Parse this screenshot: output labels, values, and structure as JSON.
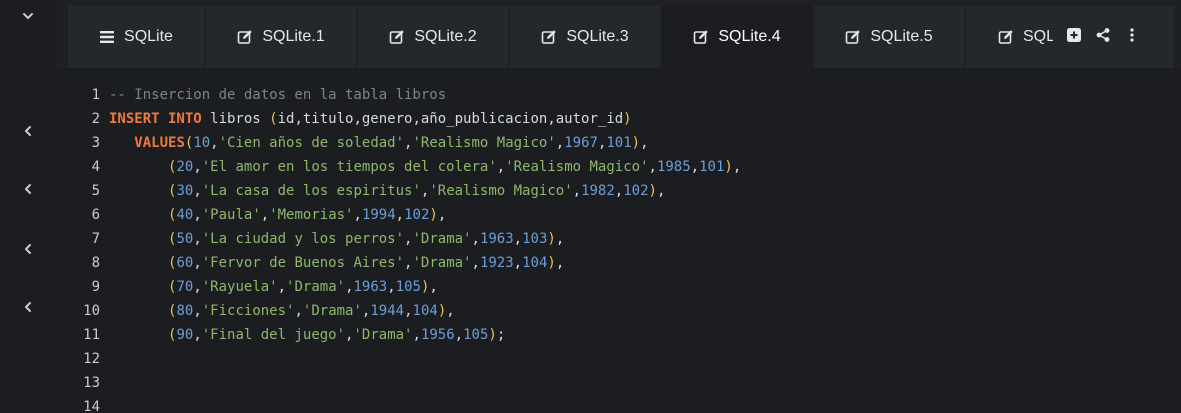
{
  "colors": {
    "background": "#1b1d20",
    "tab_bg": "#24272b",
    "keyword": "#ee7a3b",
    "number": "#6c9ed8",
    "string": "#8fb86a",
    "paren": "#e6c45a",
    "comment": "#7c848e"
  },
  "rail": {
    "items": [
      {
        "icon": "chevron-down-icon"
      },
      {
        "icon": "chevron-left-icon"
      },
      {
        "icon": "chevron-left-icon"
      },
      {
        "icon": "chevron-left-icon"
      },
      {
        "icon": "chevron-left-icon"
      }
    ]
  },
  "tabs": [
    {
      "label": "SQLite",
      "icon": "list-icon",
      "active": false
    },
    {
      "label": "SQLite.1",
      "icon": "edit-icon",
      "active": false
    },
    {
      "label": "SQLite.2",
      "icon": "edit-icon",
      "active": false
    },
    {
      "label": "SQLite.3",
      "icon": "edit-icon",
      "active": false
    },
    {
      "label": "SQLite.4",
      "icon": "edit-icon",
      "active": true
    },
    {
      "label": "SQLite.5",
      "icon": "edit-icon",
      "active": false
    },
    {
      "label": "SQL",
      "icon": "edit-icon",
      "active": false
    }
  ],
  "tab_actions": [
    {
      "icon": "plus-square-icon"
    },
    {
      "icon": "share-icon"
    },
    {
      "icon": "more-vertical-icon"
    }
  ],
  "editor": {
    "lines": [
      {
        "n": "1",
        "tokens": [
          {
            "t": "-- Insercion de datos en la tabla libros",
            "c": "cmt"
          }
        ]
      },
      {
        "n": "2",
        "tokens": [
          {
            "t": "INSERT INTO",
            "c": "kw"
          },
          {
            "t": " libros ",
            "c": "plain"
          },
          {
            "t": "(",
            "c": "par"
          },
          {
            "t": "id,titulo,genero,año_publicacion,autor_id",
            "c": "plain"
          },
          {
            "t": ")",
            "c": "par"
          }
        ]
      },
      {
        "n": "3",
        "tokens": [
          {
            "t": "   ",
            "c": "plain"
          },
          {
            "t": "VALUES",
            "c": "kw"
          },
          {
            "t": "(",
            "c": "par"
          },
          {
            "t": "10",
            "c": "num"
          },
          {
            "t": ",",
            "c": "plain"
          },
          {
            "t": "'Cien años de soledad'",
            "c": "str"
          },
          {
            "t": ",",
            "c": "plain"
          },
          {
            "t": "'Realismo Magico'",
            "c": "str"
          },
          {
            "t": ",",
            "c": "plain"
          },
          {
            "t": "1967",
            "c": "num"
          },
          {
            "t": ",",
            "c": "plain"
          },
          {
            "t": "101",
            "c": "num"
          },
          {
            "t": ")",
            "c": "par"
          },
          {
            "t": ",",
            "c": "plain"
          }
        ]
      },
      {
        "n": "4",
        "tokens": [
          {
            "t": "       ",
            "c": "plain"
          },
          {
            "t": "(",
            "c": "par"
          },
          {
            "t": "20",
            "c": "num"
          },
          {
            "t": ",",
            "c": "plain"
          },
          {
            "t": "'El amor en los tiempos del colera'",
            "c": "str"
          },
          {
            "t": ",",
            "c": "plain"
          },
          {
            "t": "'Realismo Magico'",
            "c": "str"
          },
          {
            "t": ",",
            "c": "plain"
          },
          {
            "t": "1985",
            "c": "num"
          },
          {
            "t": ",",
            "c": "plain"
          },
          {
            "t": "101",
            "c": "num"
          },
          {
            "t": ")",
            "c": "par"
          },
          {
            "t": ",",
            "c": "plain"
          }
        ]
      },
      {
        "n": "5",
        "tokens": [
          {
            "t": "       ",
            "c": "plain"
          },
          {
            "t": "(",
            "c": "par"
          },
          {
            "t": "30",
            "c": "num"
          },
          {
            "t": ",",
            "c": "plain"
          },
          {
            "t": "'La casa de los espiritus'",
            "c": "str"
          },
          {
            "t": ",",
            "c": "plain"
          },
          {
            "t": "'Realismo Magico'",
            "c": "str"
          },
          {
            "t": ",",
            "c": "plain"
          },
          {
            "t": "1982",
            "c": "num"
          },
          {
            "t": ",",
            "c": "plain"
          },
          {
            "t": "102",
            "c": "num"
          },
          {
            "t": ")",
            "c": "par"
          },
          {
            "t": ",",
            "c": "plain"
          }
        ]
      },
      {
        "n": "6",
        "tokens": [
          {
            "t": "       ",
            "c": "plain"
          },
          {
            "t": "(",
            "c": "par"
          },
          {
            "t": "40",
            "c": "num"
          },
          {
            "t": ",",
            "c": "plain"
          },
          {
            "t": "'Paula'",
            "c": "str"
          },
          {
            "t": ",",
            "c": "plain"
          },
          {
            "t": "'Memorias'",
            "c": "str"
          },
          {
            "t": ",",
            "c": "plain"
          },
          {
            "t": "1994",
            "c": "num"
          },
          {
            "t": ",",
            "c": "plain"
          },
          {
            "t": "102",
            "c": "num"
          },
          {
            "t": ")",
            "c": "par"
          },
          {
            "t": ",",
            "c": "plain"
          }
        ]
      },
      {
        "n": "7",
        "tokens": [
          {
            "t": "       ",
            "c": "plain"
          },
          {
            "t": "(",
            "c": "par"
          },
          {
            "t": "50",
            "c": "num"
          },
          {
            "t": ",",
            "c": "plain"
          },
          {
            "t": "'La ciudad y los perros'",
            "c": "str"
          },
          {
            "t": ",",
            "c": "plain"
          },
          {
            "t": "'Drama'",
            "c": "str"
          },
          {
            "t": ",",
            "c": "plain"
          },
          {
            "t": "1963",
            "c": "num"
          },
          {
            "t": ",",
            "c": "plain"
          },
          {
            "t": "103",
            "c": "num"
          },
          {
            "t": ")",
            "c": "par"
          },
          {
            "t": ",",
            "c": "plain"
          }
        ]
      },
      {
        "n": "8",
        "tokens": [
          {
            "t": "       ",
            "c": "plain"
          },
          {
            "t": "(",
            "c": "par"
          },
          {
            "t": "60",
            "c": "num"
          },
          {
            "t": ",",
            "c": "plain"
          },
          {
            "t": "'Fervor de Buenos Aires'",
            "c": "str"
          },
          {
            "t": ",",
            "c": "plain"
          },
          {
            "t": "'Drama'",
            "c": "str"
          },
          {
            "t": ",",
            "c": "plain"
          },
          {
            "t": "1923",
            "c": "num"
          },
          {
            "t": ",",
            "c": "plain"
          },
          {
            "t": "104",
            "c": "num"
          },
          {
            "t": ")",
            "c": "par"
          },
          {
            "t": ",",
            "c": "plain"
          }
        ]
      },
      {
        "n": "9",
        "tokens": [
          {
            "t": "       ",
            "c": "plain"
          },
          {
            "t": "(",
            "c": "par"
          },
          {
            "t": "70",
            "c": "num"
          },
          {
            "t": ",",
            "c": "plain"
          },
          {
            "t": "'Rayuela'",
            "c": "str"
          },
          {
            "t": ",",
            "c": "plain"
          },
          {
            "t": "'Drama'",
            "c": "str"
          },
          {
            "t": ",",
            "c": "plain"
          },
          {
            "t": "1963",
            "c": "num"
          },
          {
            "t": ",",
            "c": "plain"
          },
          {
            "t": "105",
            "c": "num"
          },
          {
            "t": ")",
            "c": "par"
          },
          {
            "t": ",",
            "c": "plain"
          }
        ]
      },
      {
        "n": "10",
        "tokens": [
          {
            "t": "       ",
            "c": "plain"
          },
          {
            "t": "(",
            "c": "par"
          },
          {
            "t": "80",
            "c": "num"
          },
          {
            "t": ",",
            "c": "plain"
          },
          {
            "t": "'Ficciones'",
            "c": "str"
          },
          {
            "t": ",",
            "c": "plain"
          },
          {
            "t": "'Drama'",
            "c": "str"
          },
          {
            "t": ",",
            "c": "plain"
          },
          {
            "t": "1944",
            "c": "num"
          },
          {
            "t": ",",
            "c": "plain"
          },
          {
            "t": "104",
            "c": "num"
          },
          {
            "t": ")",
            "c": "par"
          },
          {
            "t": ",",
            "c": "plain"
          }
        ]
      },
      {
        "n": "11",
        "tokens": [
          {
            "t": "       ",
            "c": "plain"
          },
          {
            "t": "(",
            "c": "par"
          },
          {
            "t": "90",
            "c": "num"
          },
          {
            "t": ",",
            "c": "plain"
          },
          {
            "t": "'Final del juego'",
            "c": "str"
          },
          {
            "t": ",",
            "c": "plain"
          },
          {
            "t": "'Drama'",
            "c": "str"
          },
          {
            "t": ",",
            "c": "plain"
          },
          {
            "t": "1956",
            "c": "num"
          },
          {
            "t": ",",
            "c": "plain"
          },
          {
            "t": "105",
            "c": "num"
          },
          {
            "t": ")",
            "c": "par"
          },
          {
            "t": ";",
            "c": "plain"
          }
        ]
      },
      {
        "n": "12",
        "tokens": []
      },
      {
        "n": "13",
        "tokens": []
      },
      {
        "n": "14",
        "tokens": []
      }
    ]
  }
}
